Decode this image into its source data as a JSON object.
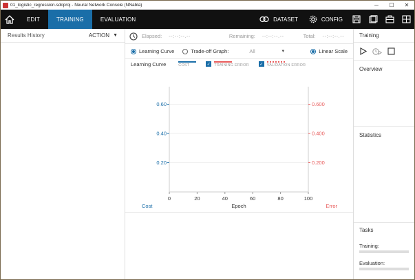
{
  "window": {
    "title": "01_logistic_regression.sdcproj - Neural Network Console (NNabla)",
    "minimize": "─",
    "maximize": "☐",
    "close": "✕"
  },
  "nav": {
    "tabs": [
      {
        "label": "EDIT"
      },
      {
        "label": "TRAINING"
      },
      {
        "label": "EVALUATION"
      }
    ],
    "dataset_label": "DATASET",
    "config_label": "CONFIG"
  },
  "results": {
    "title": "Results History",
    "action_label": "ACTION"
  },
  "timer": {
    "elapsed_label": "Elapsed:",
    "elapsed_value": "--:--:--.--",
    "remaining_label": "Remaining:",
    "remaining_value": "--:--:--.--",
    "total_label": "Total:",
    "total_value": "--:--:--.--"
  },
  "options": {
    "learning_curve": "Learning Curve",
    "tradeoff_graph": "Trade-off Graph:",
    "tradeoff_value": "All",
    "linear_scale": "Linear Scale"
  },
  "legend": {
    "title": "Learning Curve",
    "cost": "COST",
    "training_error": "TRAINING ERROR",
    "validation_error": "VALIDATION ERROR",
    "cost_color": "#1a6ea8",
    "training_color": "#e85a5a",
    "validation_color": "#e85a5a"
  },
  "chart_data": {
    "type": "line",
    "x": [
      0,
      20,
      40,
      60,
      80,
      100
    ],
    "xlabel": "Epoch",
    "xlim": [
      0,
      100
    ],
    "y_left_label": "Cost",
    "y_left_ticks": [
      "0.20",
      "0.40",
      "0.60"
    ],
    "y_right_label": "Error",
    "y_right_ticks": [
      "0.200",
      "0.400",
      "0.600"
    ],
    "series": []
  },
  "right": {
    "training_title": "Training",
    "overview_title": "Overview",
    "statistics_title": "Statistics",
    "tasks_title": "Tasks",
    "training_task": "Training:",
    "evaluation_task": "Evaluation:"
  }
}
